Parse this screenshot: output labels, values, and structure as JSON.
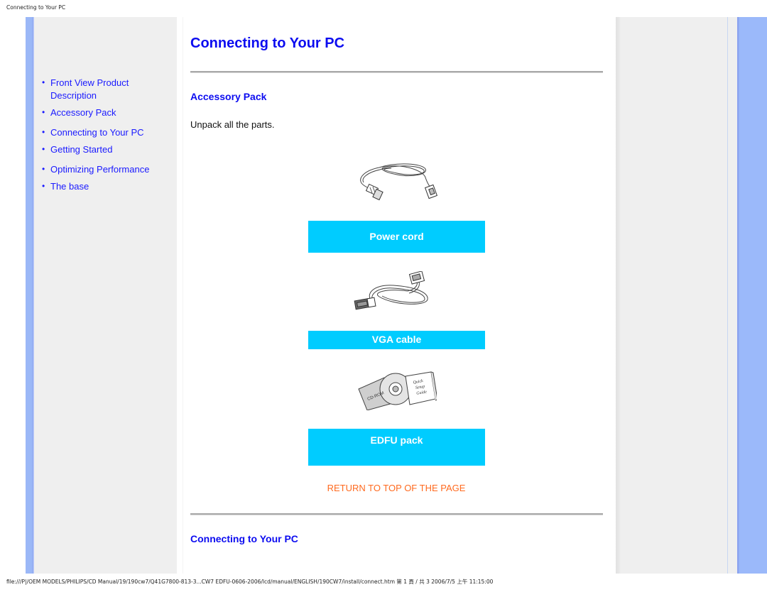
{
  "print_header": "Connecting to Your PC",
  "print_footer": "file:///P|/OEM MODELS/PHILIPS/CD Manual/19/190cw7/Q41G7800-813-3...CW7 EDFU-0606-2006/lcd/manual/ENGLISH/190CW7/install/connect.htm 第 1 頁 / 共 3 2006/7/5 上午 11:15:00",
  "sidebar": {
    "items": [
      {
        "label": "Front View Product Description"
      },
      {
        "label": "Accessory Pack"
      },
      {
        "label": "Connecting to Your PC"
      },
      {
        "label": "Getting Started"
      },
      {
        "label": "Optimizing Performance"
      },
      {
        "label": "The base"
      }
    ],
    "bullet": "•"
  },
  "main": {
    "title": "Connecting to Your PC",
    "accessory_heading": "Accessory Pack",
    "intro": "Unpack all the parts.",
    "items": [
      {
        "label": "Power cord",
        "icon": "power-cord-icon"
      },
      {
        "label": "VGA cable",
        "icon": "vga-cable-icon"
      },
      {
        "label": "EDFU pack",
        "icon": "edfu-pack-icon"
      }
    ],
    "edfu_cd_text": "CD-ROM",
    "edfu_guide_text": [
      "Quick",
      "Setup",
      "Guide"
    ],
    "return_link": "RETURN TO TOP OF THE PAGE",
    "connecting_heading": "Connecting to Your PC"
  },
  "colors": {
    "heading_blue": "#0c0cf0",
    "label_cyan": "#00ccff",
    "return_orange": "#ff6a1f",
    "stripe_blue": "#9bb9fa",
    "panel_grey": "#efefef"
  }
}
